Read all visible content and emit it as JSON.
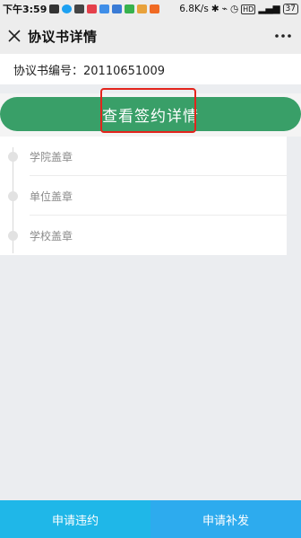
{
  "status_bar": {
    "time": "下午3:59",
    "network_speed": "6.8K/s",
    "battery": "37"
  },
  "header": {
    "title": "协议书详情",
    "close_icon": "close-icon",
    "more_icon": "more-icon"
  },
  "agreement": {
    "number_text": "协议书编号：20110651009"
  },
  "detail_button": {
    "label": "查看签约详情",
    "color": "#399f68",
    "highlight_color": "#e3241c"
  },
  "timeline": {
    "items": [
      {
        "label": "学院盖章"
      },
      {
        "label": "单位盖章"
      },
      {
        "label": "学校盖章"
      }
    ]
  },
  "bottom_bar": {
    "violation_label": "申请违约",
    "reissue_label": "申请补发"
  }
}
